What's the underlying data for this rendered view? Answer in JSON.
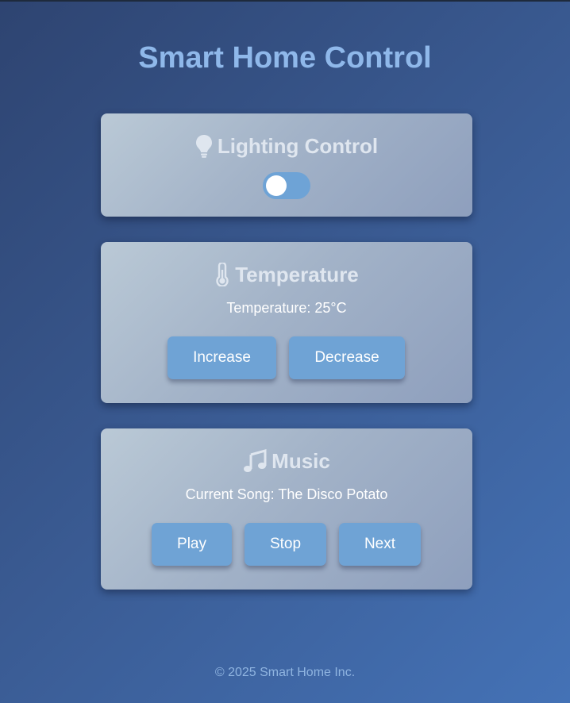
{
  "page": {
    "title": "Smart Home Control"
  },
  "lighting": {
    "heading": "Lighting Control",
    "icon": "lightbulb-icon",
    "toggle_on": false
  },
  "temperature": {
    "heading": "Temperature",
    "icon": "thermometer-icon",
    "status": "Temperature: 25°C",
    "increase_label": "Increase",
    "decrease_label": "Decrease"
  },
  "music": {
    "heading": "Music",
    "icon": "music-note-icon",
    "status": "Current Song: The Disco Potato",
    "play_label": "Play",
    "stop_label": "Stop",
    "next_label": "Next"
  },
  "footer": {
    "text": "© 2025 Smart Home Inc."
  },
  "colors": {
    "title": "#8fb8ea",
    "button": "#6fa3d5",
    "toggle_track": "#6ea3d6",
    "card_heading": "#dfe6ef"
  }
}
